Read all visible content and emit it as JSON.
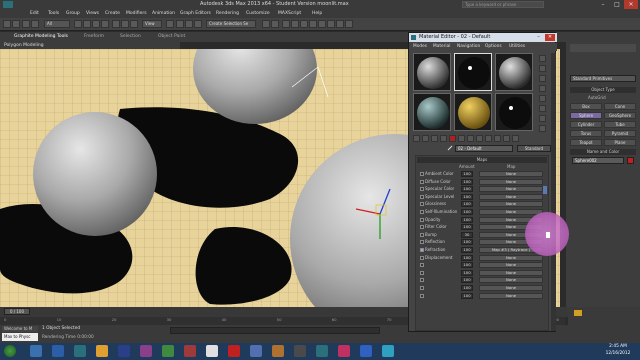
{
  "app": {
    "title": "Autodesk 3ds Max  2013 x64  -  Student Version   moonlit.max",
    "search_placeholder": "Type a keyword or phrase"
  },
  "menu": [
    "Edit",
    "Tools",
    "Group",
    "Views",
    "Create",
    "Modifiers",
    "Animation",
    "Graph Editors",
    "Rendering",
    "Customize",
    "MAXScript",
    "Help"
  ],
  "toolbar": {
    "filter": "All",
    "view": "View",
    "selection_set": "Create Selection Se"
  },
  "ribbon": {
    "tabs": [
      "Graphite Modeling Tools",
      "Freeform",
      "Selection",
      "Object Paint"
    ],
    "sub": "Polygon Modeling"
  },
  "material_editor": {
    "title": "Material Editor - 02 - Default",
    "menu": [
      "Modes",
      "Material",
      "Navigation",
      "Options",
      "Utilities"
    ],
    "material_name": "02 - Default",
    "material_type": "Standard",
    "maps_header": "Maps",
    "columns": {
      "amount": "Amount",
      "map": "Map"
    },
    "maps": [
      {
        "label": "Ambient Color",
        "amount": "100",
        "map": "None"
      },
      {
        "label": "Diffuse Color",
        "amount": "100",
        "map": "None"
      },
      {
        "label": "Specular Color",
        "amount": "100",
        "map": "None"
      },
      {
        "label": "Specular Level",
        "amount": "100",
        "map": "None"
      },
      {
        "label": "Glossiness",
        "amount": "100",
        "map": "None"
      },
      {
        "label": "Self-Illumination",
        "amount": "100",
        "map": "None"
      },
      {
        "label": "Opacity",
        "amount": "100",
        "map": "None"
      },
      {
        "label": "Filter Color",
        "amount": "100",
        "map": "None"
      },
      {
        "label": "Bump",
        "amount": "30",
        "map": "None"
      },
      {
        "label": "Reflection",
        "amount": "100",
        "map": "None"
      },
      {
        "label": "Refraction",
        "amount": "100",
        "map": "Map #3  ( Raytrace )"
      },
      {
        "label": "Displacement",
        "amount": "100",
        "map": "None"
      },
      {
        "label": "",
        "amount": "100",
        "map": "None"
      },
      {
        "label": "",
        "amount": "100",
        "map": "None"
      },
      {
        "label": "",
        "amount": "100",
        "map": "None"
      },
      {
        "label": "",
        "amount": "100",
        "map": "None"
      },
      {
        "label": "",
        "amount": "100",
        "map": "None"
      }
    ]
  },
  "command_panel": {
    "dropdown": "Standard Primitives",
    "object_type": "Object Type",
    "autogrid": "AutoGrid",
    "buttons": [
      "Box",
      "Cone",
      "Sphere",
      "GeoSphere",
      "Cylinder",
      "Tube",
      "Torus",
      "Pyramid",
      "Teapot",
      "Plane"
    ],
    "name_and_color": "Name and Color",
    "object_name": "Sphere002"
  },
  "timeline": {
    "frame": "0 / 100",
    "ticks": [
      "0",
      "10",
      "20",
      "30",
      "40",
      "50",
      "60",
      "70",
      "80",
      "90",
      "100"
    ]
  },
  "status": {
    "selected": "1 Object Selected",
    "rendering_time": "Rendering Time  0:00:00",
    "maxscript": "Max to Physc",
    "welcome": "Welcome to M"
  },
  "taskbar": {
    "time": "2:45 AM",
    "date": "12/16/2012"
  },
  "colors": {
    "viewport_bg": "#e8d49a",
    "shadow": "#0a0a0a",
    "sphere": "#a8a8a8",
    "accent": "#c46ac4"
  }
}
